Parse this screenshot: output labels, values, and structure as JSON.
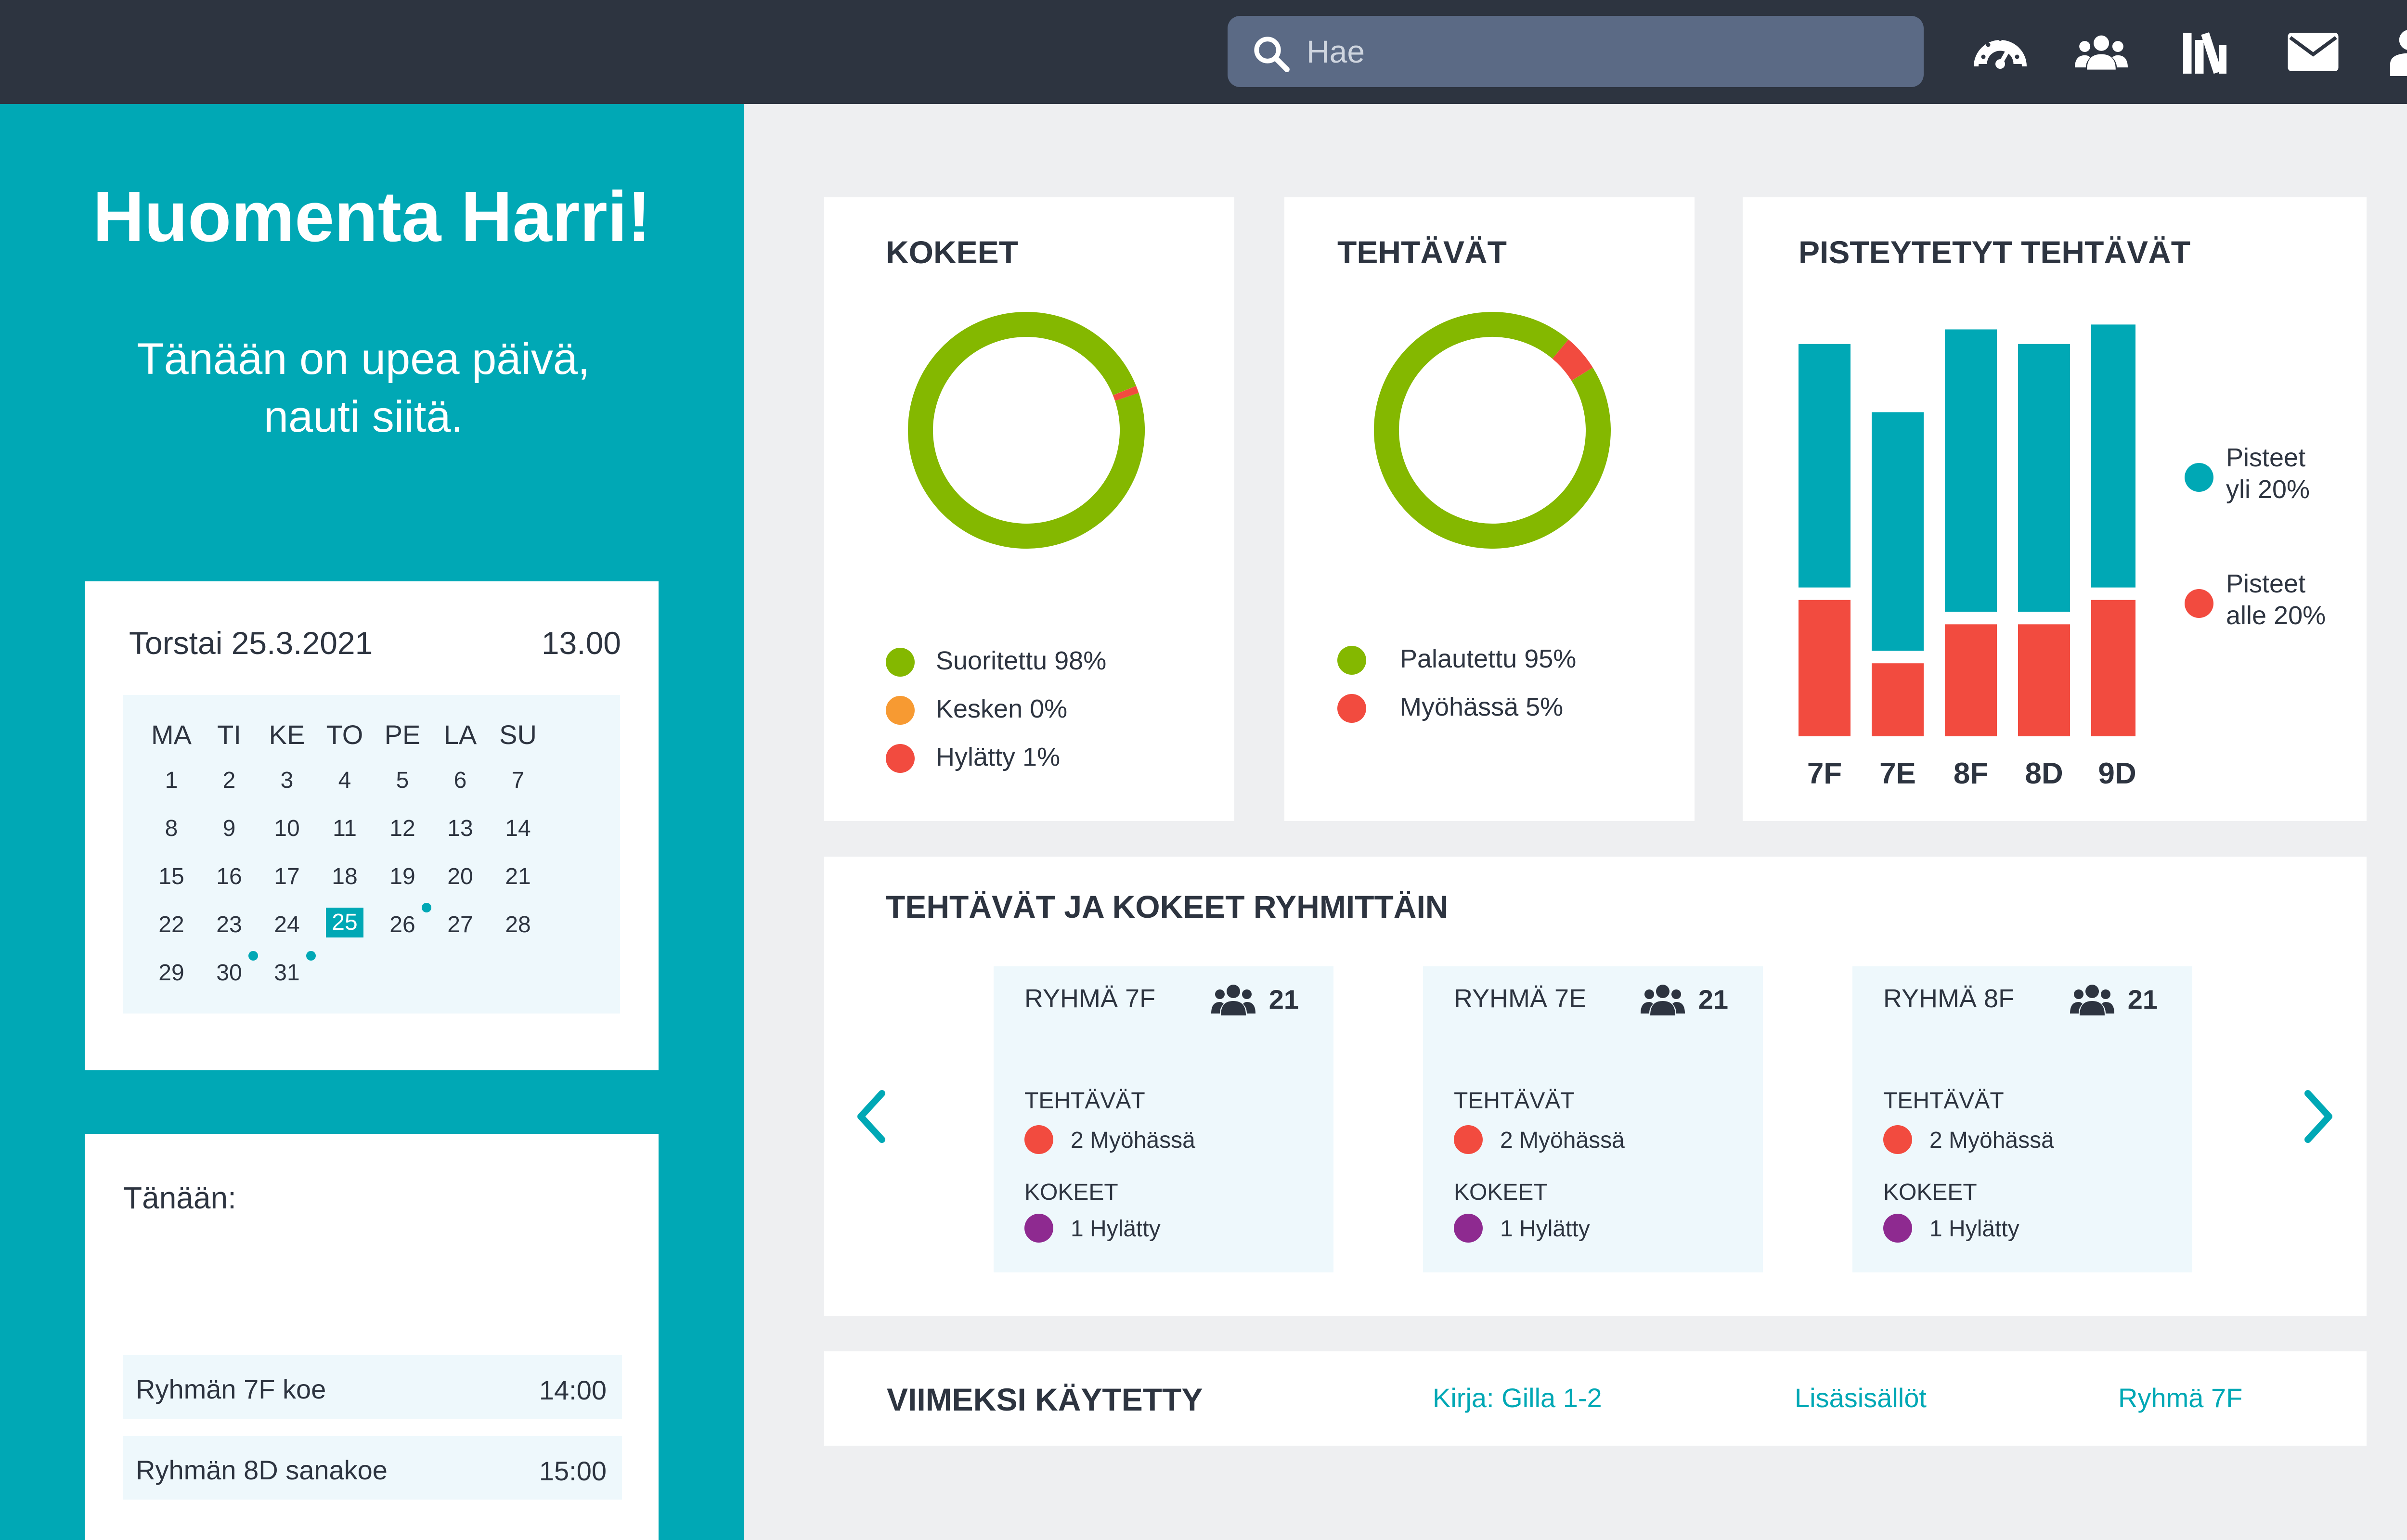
{
  "search": {
    "placeholder": "Hae"
  },
  "nav_icons": [
    "dashboard-gauge-icon",
    "users-icon",
    "library-icon",
    "mail-icon",
    "user-icon"
  ],
  "sidebar": {
    "greeting": "Huomenta Harri!",
    "subtitle_line1": "Tänään on upea päivä,",
    "subtitle_line2": "nauti siitä."
  },
  "calendar": {
    "date_label": "Torstai 25.3.2021",
    "time": "13.00",
    "weekdays": [
      "MA",
      "TI",
      "KE",
      "TO",
      "PE",
      "LA",
      "SU"
    ],
    "weeks": [
      [
        "1",
        "2",
        "3",
        "4",
        "5",
        "6",
        "7"
      ],
      [
        "8",
        "9",
        "10",
        "11",
        "12",
        "13",
        "14"
      ],
      [
        "15",
        "16",
        "17",
        "18",
        "19",
        "20",
        "21"
      ],
      [
        "22",
        "23",
        "24",
        "25",
        "26",
        "27",
        "28"
      ],
      [
        "29",
        "30",
        "31",
        "",
        "",
        "",
        ""
      ]
    ],
    "selected_day": "25",
    "event_days": [
      "26",
      "30",
      "31"
    ]
  },
  "today": {
    "title": "Tänään:",
    "items": [
      {
        "label": "Ryhmän 7F koe",
        "time": "14:00"
      },
      {
        "label": "Ryhmän 8D sanakoe",
        "time": "15:00"
      }
    ]
  },
  "kokeet": {
    "title": "KOKEET",
    "legend": [
      {
        "label": "Suoritettu 98%",
        "color": "#84b800"
      },
      {
        "label": "Kesken 0%",
        "color": "#f79a32"
      },
      {
        "label": "Hylätty 1%",
        "color": "#f24b3f"
      }
    ]
  },
  "tehtavat": {
    "title": "TEHTÄVÄT",
    "legend": [
      {
        "label": "Palautettu 95%",
        "color": "#84b800"
      },
      {
        "label": "Myöhässä 5%",
        "color": "#f24b3f"
      }
    ]
  },
  "pisteytetyt": {
    "title": "PISTEYTETYT TEHTÄVÄT",
    "legend": [
      {
        "line1": "Pisteet",
        "line2": "yli 20%",
        "color": "#00a8b5"
      },
      {
        "line1": "Pisteet",
        "line2": "alle 20%",
        "color": "#f24b3f"
      }
    ]
  },
  "chart_data": [
    {
      "type": "pie",
      "title": "KOKEET",
      "labels": [
        "Suoritettu",
        "Kesken",
        "Hylätty"
      ],
      "values": [
        98,
        0,
        1
      ],
      "colors": [
        "#84b800",
        "#f79a32",
        "#f24b3f"
      ]
    },
    {
      "type": "pie",
      "title": "TEHTÄVÄT",
      "labels": [
        "Palautettu",
        "Myöhässä"
      ],
      "values": [
        95,
        5
      ],
      "colors": [
        "#84b800",
        "#f24b3f"
      ]
    },
    {
      "type": "bar",
      "title": "PISTEYTETYT TEHTÄVÄT",
      "stacked": true,
      "categories": [
        "7F",
        "7E",
        "8F",
        "8D",
        "9D"
      ],
      "series": [
        {
          "name": "Pisteet alle 20%",
          "values": [
            28,
            15,
            23,
            23,
            28
          ],
          "color": "#f24b3f"
        },
        {
          "name": "Pisteet yli 20%",
          "values": [
            50,
            49,
            58,
            55,
            54
          ],
          "color": "#00a8b5"
        }
      ],
      "ylim": [
        0,
        85
      ]
    }
  ],
  "groups_section": {
    "title": "TEHTÄVÄT JA KOKEET RYHMITTÄIN",
    "groups": [
      {
        "name": "RYHMÄ 7F",
        "count": "21",
        "tasks_label": "TEHTÄVÄT",
        "tasks_status": "2 Myöhässä",
        "exams_label": "KOKEET",
        "exams_status": "1 Hylätty"
      },
      {
        "name": "RYHMÄ 7E",
        "count": "21",
        "tasks_label": "TEHTÄVÄT",
        "tasks_status": "2 Myöhässä",
        "exams_label": "KOKEET",
        "exams_status": "1 Hylätty"
      },
      {
        "name": "RYHMÄ 8F",
        "count": "21",
        "tasks_label": "TEHTÄVÄT",
        "tasks_status": "2 Myöhässä",
        "exams_label": "KOKEET",
        "exams_status": "1 Hylätty"
      }
    ],
    "late_color": "#f24b3f",
    "failed_color": "#8e2a90"
  },
  "recent": {
    "title": "VIIMEKSI KÄYTETTY",
    "links": [
      "Kirja: Gilla 1-2",
      "Lisäsisällöt",
      "Ryhmä 7F"
    ]
  },
  "colors": {
    "topbar": "#2d3440",
    "accent": "#00a8b5",
    "green": "#84b800",
    "red": "#f24b3f",
    "orange": "#f79a32",
    "purple": "#8e2a90"
  }
}
